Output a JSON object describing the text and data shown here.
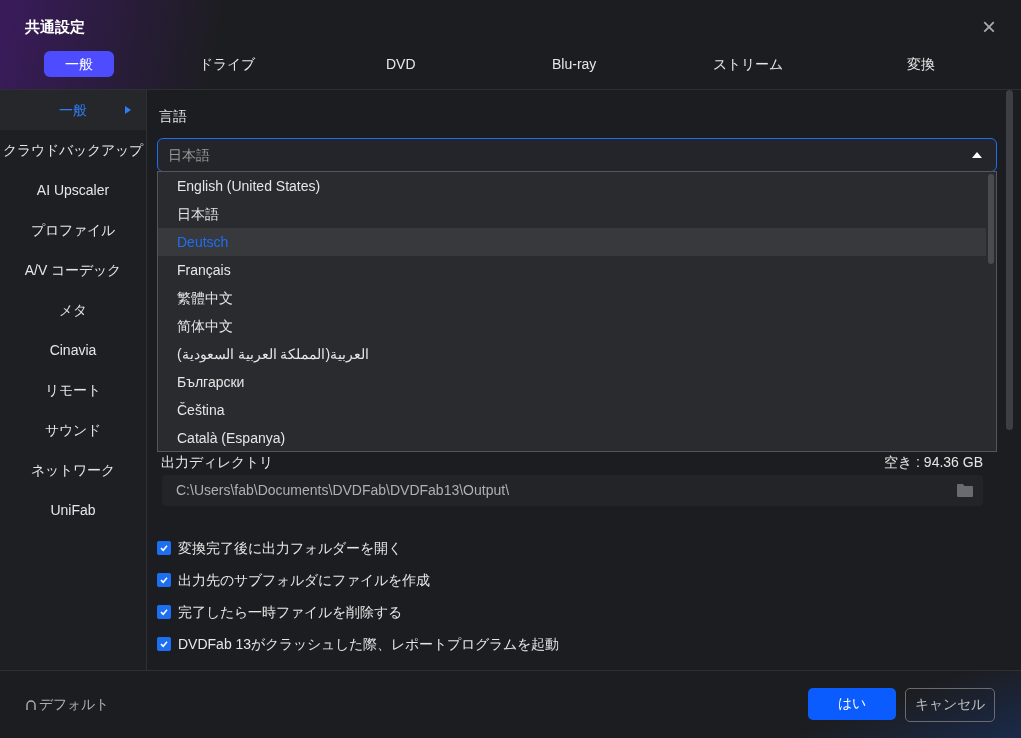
{
  "window": {
    "title": "共通設定",
    "close": "×"
  },
  "tabs": [
    {
      "label": "一般",
      "selected": true
    },
    {
      "label": "ドライブ",
      "selected": false
    },
    {
      "label": "DVD",
      "selected": false
    },
    {
      "label": "Blu-ray",
      "selected": false
    },
    {
      "label": "ストリーム",
      "selected": false
    },
    {
      "label": "変換",
      "selected": false
    }
  ],
  "sidebar": {
    "items": [
      {
        "label": "一般",
        "selected": true
      },
      {
        "label": "クラウドバックアップ",
        "selected": false
      },
      {
        "label": "AI Upscaler",
        "selected": false
      },
      {
        "label": "プロファイル",
        "selected": false
      },
      {
        "label": "A/V コーデック",
        "selected": false
      },
      {
        "label": "メタ",
        "selected": false
      },
      {
        "label": "Cinavia",
        "selected": false
      },
      {
        "label": "リモート",
        "selected": false
      },
      {
        "label": "サウンド",
        "selected": false
      },
      {
        "label": "ネットワーク",
        "selected": false
      },
      {
        "label": "UniFab",
        "selected": false
      }
    ]
  },
  "language": {
    "label": "言語",
    "value": "日本語",
    "expanded": true,
    "options": [
      {
        "label": "English (United States)",
        "highlighted": false
      },
      {
        "label": "日本語",
        "highlighted": false
      },
      {
        "label": "Deutsch",
        "highlighted": true
      },
      {
        "label": "Français",
        "highlighted": false
      },
      {
        "label": "繁體中文",
        "highlighted": false
      },
      {
        "label": "简体中文",
        "highlighted": false
      },
      {
        "label": "العربية(المملكة العربية السعودية)",
        "highlighted": false
      },
      {
        "label": "Български",
        "highlighted": false
      },
      {
        "label": "Čeština",
        "highlighted": false
      },
      {
        "label": "Català (Espanya)",
        "highlighted": false
      }
    ]
  },
  "output": {
    "label": "出力ディレクトリ",
    "free_space": "空き : 94.36 GB",
    "path": "C:\\Users\\fab\\Documents\\DVDFab\\DVDFab13\\Output\\"
  },
  "options": [
    {
      "label": "変換完了後に出力フォルダーを開く",
      "checked": true
    },
    {
      "label": "出力先のサブフォルダにファイルを作成",
      "checked": true
    },
    {
      "label": "完了したら一時ファイルを削除する",
      "checked": true
    },
    {
      "label": "DVDFab 13がクラッシュした際、レポートプログラムを起動",
      "checked": true
    }
  ],
  "footer": {
    "default": "デフォルト",
    "ok": "はい",
    "cancel": "キャンセル"
  }
}
